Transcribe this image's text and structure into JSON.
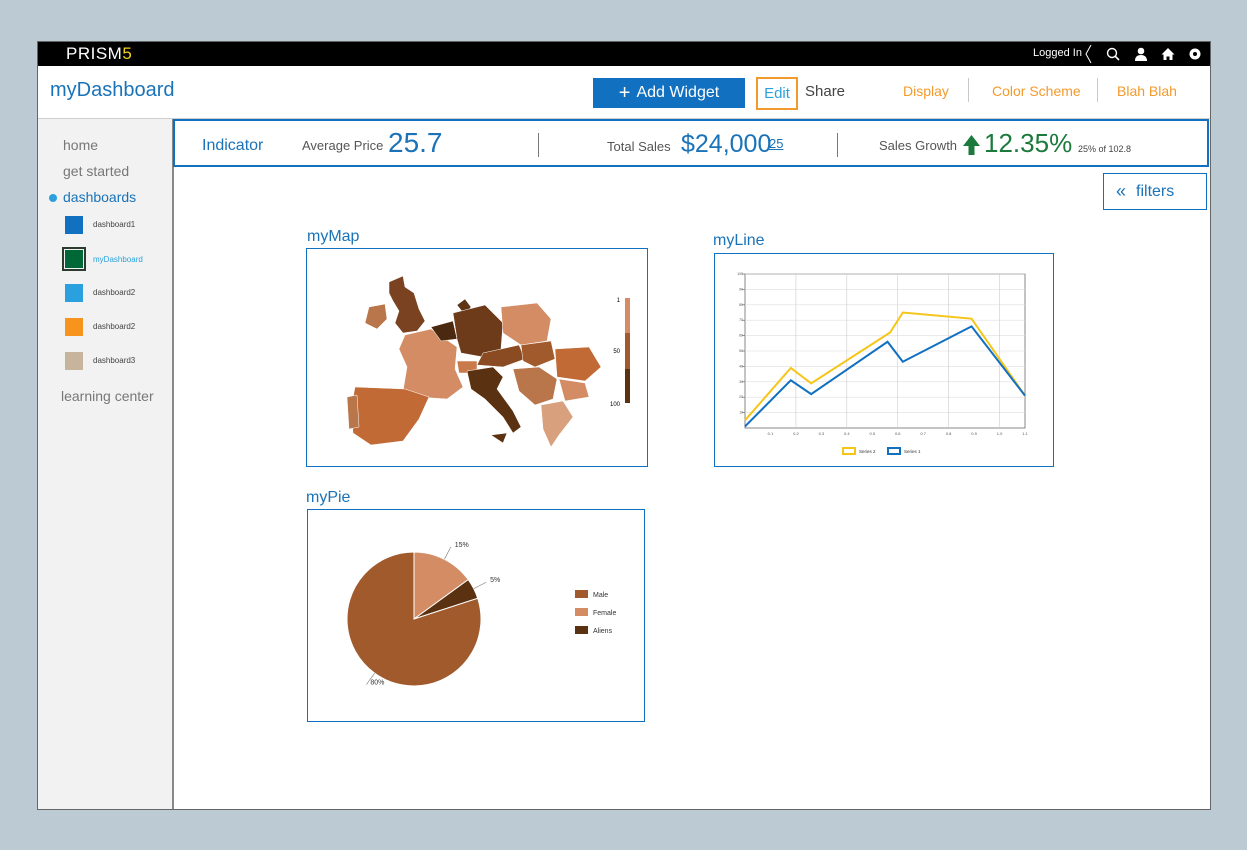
{
  "topbar": {
    "brand": "PRISM",
    "brand_accent": "5",
    "logged_in": "Logged In"
  },
  "header": {
    "title": "myDashboard",
    "add_widget": "Add Widget",
    "edit": "Edit",
    "share": "Share",
    "menu": [
      "Display",
      "Color Scheme",
      "Blah Blah"
    ]
  },
  "sidebar": {
    "items": [
      "home",
      "get started",
      "dashboards",
      "learning center"
    ],
    "dashboards": [
      {
        "label": "dashboard1",
        "color": "#1170c0"
      },
      {
        "label": "myDashboard",
        "color": "#006837"
      },
      {
        "label": "dashboard2",
        "color": "#2aa1de"
      },
      {
        "label": "dashboard2",
        "color": "#f7941d"
      },
      {
        "label": "dashboard3",
        "color": "#c6b49c"
      }
    ]
  },
  "indicator": {
    "title": "Indicator",
    "avg_label": "Average Price",
    "avg_value": "25.7",
    "sales_label": "Total Sales",
    "sales_value": "$24,000",
    "sales_sup": "25",
    "growth_label": "Sales Growth",
    "growth_value": "12.35%",
    "growth_note": "25% of 102.8"
  },
  "filters": {
    "label": "filters"
  },
  "widgets": {
    "map": {
      "title": "myMap",
      "legend_ticks": [
        "1",
        "50",
        "100"
      ]
    },
    "line": {
      "title": "myLine"
    },
    "pie": {
      "title": "myPie"
    }
  },
  "chart_data": [
    {
      "type": "line",
      "x": [
        0,
        0.1,
        0.2,
        0.3,
        0.4,
        0.5,
        0.6,
        0.7,
        0.8,
        0.9,
        1.0,
        1.1
      ],
      "x_ticks": [
        "0.1",
        "0.2",
        "0.3",
        "0.4",
        "0.5",
        "0.6",
        "0.7",
        "0.8",
        "0.9",
        "1.0",
        "1.1"
      ],
      "y_ticks": [
        "10",
        "20",
        "30",
        "40",
        "50",
        "60",
        "70",
        "80",
        "90",
        "100"
      ],
      "ylim": [
        0,
        100
      ],
      "series": [
        {
          "name": "Series 2",
          "color": "#f5c518",
          "points": [
            [
              0,
              5
            ],
            [
              0.18,
              39
            ],
            [
              0.26,
              29
            ],
            [
              0.57,
              62
            ],
            [
              0.62,
              75
            ],
            [
              0.89,
              71
            ],
            [
              1.1,
              21
            ]
          ]
        },
        {
          "name": "Series 1",
          "color": "#1170c0",
          "points": [
            [
              0,
              1
            ],
            [
              0.18,
              31
            ],
            [
              0.26,
              22
            ],
            [
              0.56,
              56
            ],
            [
              0.62,
              43
            ],
            [
              0.89,
              66
            ],
            [
              1.1,
              21
            ]
          ]
        }
      ],
      "legend": "bottom"
    },
    {
      "type": "pie",
      "slices": [
        {
          "name": "Male",
          "value": 80,
          "label": "80%",
          "color": "#a05a2c"
        },
        {
          "name": "Female",
          "value": 15,
          "label": "15%",
          "color": "#d38c63"
        },
        {
          "name": "Aliens",
          "value": 5,
          "label": "5%",
          "color": "#5a3212"
        }
      ],
      "legend": "right"
    }
  ]
}
